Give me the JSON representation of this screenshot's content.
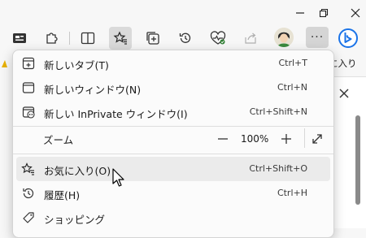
{
  "favorites_bar": {
    "partial_text": "に入り"
  },
  "menu": {
    "items": [
      {
        "label": "新しいタブ(T)",
        "shortcut": "Ctrl+T",
        "icon": "new-tab-icon"
      },
      {
        "label": "新しいウィンドウ(N)",
        "shortcut": "Ctrl+N",
        "icon": "new-window-icon"
      },
      {
        "label": "新しい InPrivate ウィンドウ(I)",
        "shortcut": "Ctrl+Shift+N",
        "icon": "inprivate-window-icon"
      }
    ],
    "zoom": {
      "label": "ズーム",
      "value": "100%",
      "minus": "−",
      "plus": "+"
    },
    "items2": [
      {
        "label": "お気に入り(O)",
        "shortcut": "Ctrl+Shift+O",
        "icon": "favorites-star-icon"
      },
      {
        "label": "履歴(H)",
        "shortcut": "Ctrl+H",
        "icon": "history-icon"
      },
      {
        "label": "ショッピング",
        "shortcut": "",
        "icon": "shopping-tag-icon"
      }
    ]
  },
  "toolbar": {
    "more_label": "···"
  },
  "colors": {
    "menu_bg": "#fbfbfb",
    "hover_bg": "#ebebeb",
    "accent_blue": "#1a73e8"
  }
}
